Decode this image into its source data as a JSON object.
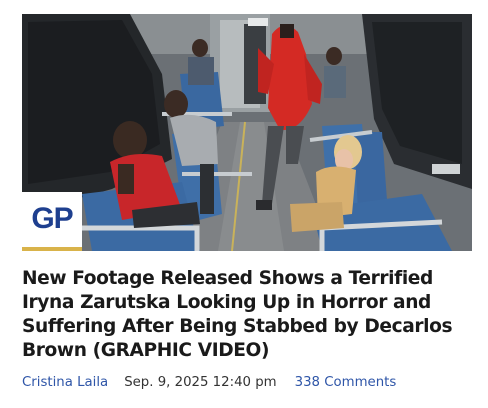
{
  "logo": {
    "text": "GP",
    "icon": "gp-logo-icon"
  },
  "article": {
    "headline": "New Footage Released Shows a Terrified Iryna Zarutska Looking Up in Horror and Suffering After Being Stabbed by Decarlos Brown (GRAPHIC VIDEO)",
    "author": "Cristina Laila",
    "date": "Sep. 9, 2025 12:40 pm",
    "comments": "338 Comments"
  },
  "colors": {
    "link": "#2f56a8",
    "headline": "#1a1a1a",
    "logo_blue": "#1e3f8f",
    "logo_gold": "#d9b34a",
    "hoodie_red": "#d42a24"
  }
}
